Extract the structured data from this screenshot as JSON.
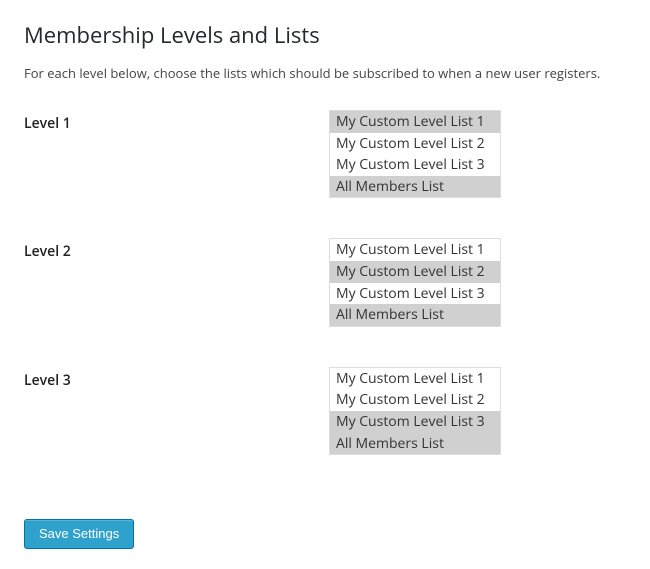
{
  "page": {
    "title": "Membership Levels and Lists",
    "description": "For each level below, choose the lists which should be subscribed to when a new user registers."
  },
  "levels": [
    {
      "label": "Level 1",
      "options": [
        {
          "label": "My Custom Level List 1",
          "selected": true
        },
        {
          "label": "My Custom Level List 2",
          "selected": false
        },
        {
          "label": "My Custom Level List 3",
          "selected": false
        },
        {
          "label": "All Members List",
          "selected": true
        }
      ]
    },
    {
      "label": "Level 2",
      "options": [
        {
          "label": "My Custom Level List 1",
          "selected": false
        },
        {
          "label": "My Custom Level List 2",
          "selected": true
        },
        {
          "label": "My Custom Level List 3",
          "selected": false
        },
        {
          "label": "All Members List",
          "selected": true
        }
      ]
    },
    {
      "label": "Level 3",
      "options": [
        {
          "label": "My Custom Level List 1",
          "selected": false
        },
        {
          "label": "My Custom Level List 2",
          "selected": false
        },
        {
          "label": "My Custom Level List 3",
          "selected": true
        },
        {
          "label": "All Members List",
          "selected": true
        }
      ]
    }
  ],
  "buttons": {
    "save": "Save Settings"
  }
}
